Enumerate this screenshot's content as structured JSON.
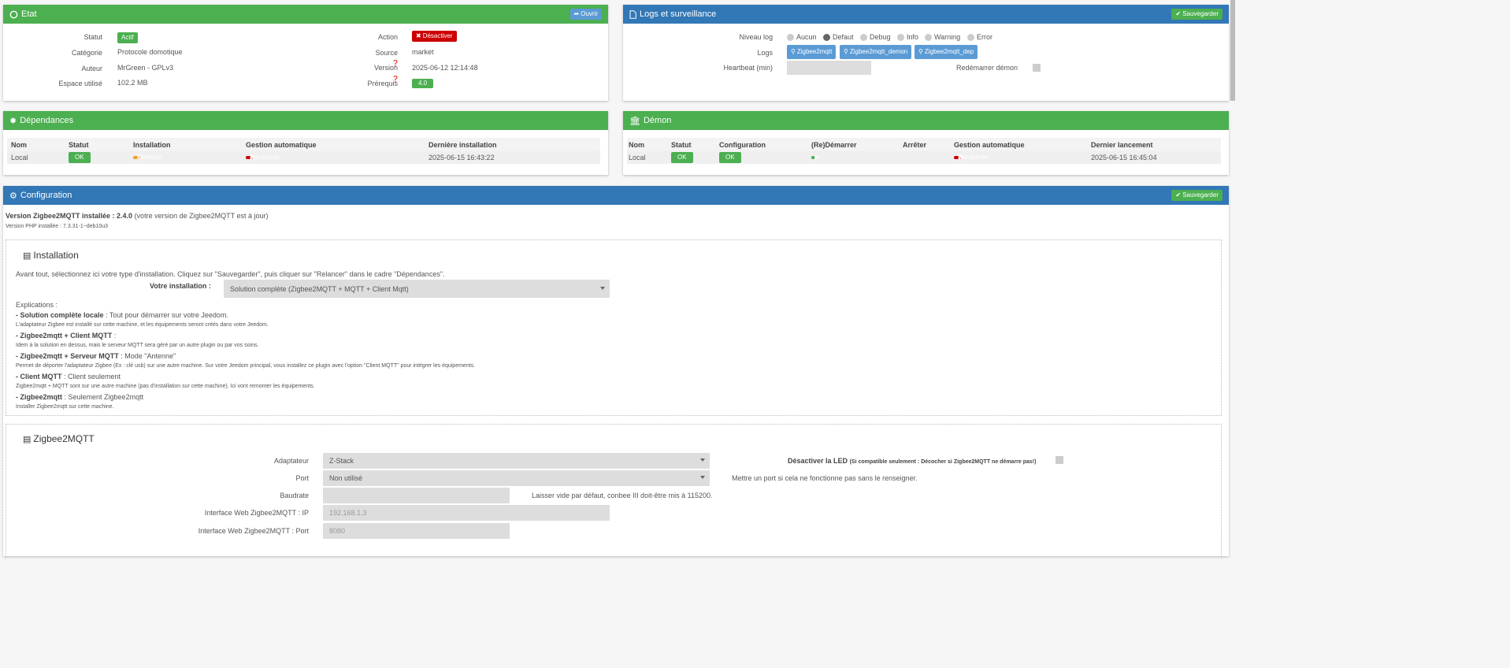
{
  "etat": {
    "title": "Etat",
    "open_button": "Ouvrir",
    "statut_label": "Statut",
    "statut_value": "Actif",
    "categorie_label": "Catégorie",
    "categorie_value": "Protocole domotique",
    "auteur_label": "Auteur",
    "auteur_value": "MrGreen - GPLv3",
    "espace_label": "Espace utilisé",
    "espace_value": "102.2 MB",
    "action_label": "Action",
    "action_button": "Désactiver",
    "source_label": "Source",
    "source_value": "market",
    "version_label": "Version",
    "version_value": "2025-06-12 12:14:48",
    "prerequis_label": "Prérequis",
    "prerequis_value": "4.0"
  },
  "logs": {
    "title": "Logs et surveillance",
    "save_button": "Sauvegarder",
    "niveau_label": "Niveau log",
    "levels": [
      {
        "label": "Aucun",
        "selected": false
      },
      {
        "label": "Defaut",
        "selected": true
      },
      {
        "label": "Debug",
        "selected": false
      },
      {
        "label": "Info",
        "selected": false
      },
      {
        "label": "Warning",
        "selected": false
      },
      {
        "label": "Error",
        "selected": false
      }
    ],
    "logs_label": "Logs",
    "log_buttons": [
      "Zigbee2mqtt",
      "Zigbee2mqtt_demon",
      "Zigbee2mqtt_dep"
    ],
    "heartbeat_label": "Heartbeat (min)",
    "heartbeat_value": "",
    "restart_label": "Redémarrer démon"
  },
  "dependances": {
    "title": "Dépendances",
    "headers": [
      "Nom",
      "Statut",
      "Installation",
      "Gestion automatique",
      "Dernière installation"
    ],
    "row": {
      "nom": "Local",
      "statut": "OK",
      "installation": "Relancer",
      "gestion": "Désactiver",
      "derniere": "2025-06-15 16:43:22"
    }
  },
  "demon": {
    "title": "Démon",
    "headers": [
      "Nom",
      "Statut",
      "Configuration",
      "(Re)Démarrer",
      "Arrêter",
      "Gestion automatique",
      "Dernier lancement"
    ],
    "row": {
      "nom": "Local",
      "statut": "OK",
      "configuration": "OK",
      "gestion": "Désactiver",
      "dernier": "2025-06-15 16:45:04"
    }
  },
  "configuration": {
    "title": "Configuration",
    "save_button": "Sauvegarder",
    "version_bold": "Version Zigbee2MQTT installée : 2.4.0",
    "version_note": " (votre version de Zigbee2MQTT est à jour)",
    "php_version": "Version PHP installée : 7.3.31-1~deb10u3",
    "installation": {
      "legend": "Installation",
      "intro": "Avant tout, sélectionnez ici votre type d'installation. Cliquez sur \"Sauvegarder\", puis cliquer sur \"Relancer\" dans le cadre \"Dépendances\".",
      "select_label": "Votre installation :",
      "select_value": "Solution complète (Zigbee2MQTT + MQTT + Client Mqtt)",
      "explications": "Explications :",
      "items": [
        {
          "bold": "- Solution complète locale",
          "rest": " : Tout pour démarrer sur votre Jeedom.",
          "desc": "L'adaptateur Zigbee est installé sur cette machine, et les équipements seront créés dans votre Jeedom."
        },
        {
          "bold": "- Zigbee2mqtt + Client MQTT",
          "rest": " :",
          "desc": "Idem à la solution en dessus, mais le serveur MQTT sera géré par un autre plugin ou par vos soins."
        },
        {
          "bold": "- Zigbee2mqtt + Serveur MQTT",
          "rest": " : Mode \"Antenne\"",
          "desc": "Permet de déporter l'adaptateur Zigbee (Ex : clé usb) sur une autre machine. Sur votre Jeedom principal, vous installez ce plugin avec l'option \"Client MQTT\" pour intégrer les équipements."
        },
        {
          "bold": "- Client MQTT",
          "rest": " : Client seulement",
          "desc": "Zigbee2mqtt + MQTT sont sur une autre machine (pas d'installation sur cette machine). Ici vont remonter les équipements."
        },
        {
          "bold": "- Zigbee2mqtt",
          "rest": " : Seulement Zigbee2mqtt",
          "desc": "Installer Zigbee2mqtt sur cette machine."
        }
      ]
    },
    "zigbee": {
      "legend": "Zigbee2MQTT",
      "adaptateur_label": "Adaptateur",
      "adaptateur_value": "Z-Stack",
      "port_label": "Port",
      "port_value": "Non utilisé",
      "port_help": "Mettre un port si cela ne fonctionne pas sans le renseigner.",
      "baudrate_label": "Baudrate",
      "baudrate_value": "",
      "baudrate_help": "Laisser vide par défaut, conbee III doit-être mis à 115200.",
      "ip_label": "Interface Web Zigbee2MQTT : IP",
      "ip_placeholder": "192.168.1.3",
      "webport_label": "Interface Web Zigbee2MQTT : Port",
      "webport_placeholder": "8080",
      "led_label": "Désactiver la LED",
      "led_note": "(Si compatible seulement : Décocher si Zigbee2MQTT ne démarre pas!)"
    }
  }
}
